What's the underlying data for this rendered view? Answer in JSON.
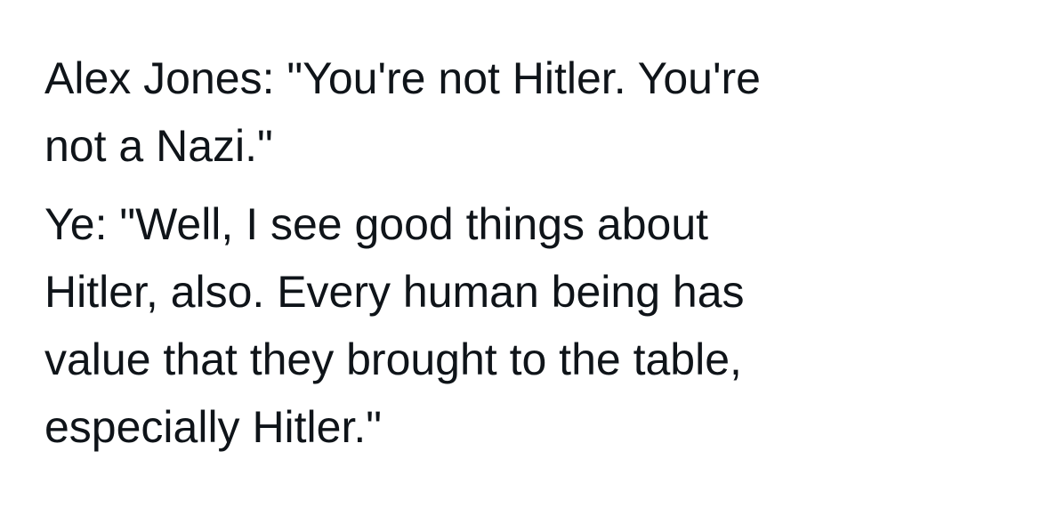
{
  "tweet": {
    "paragraphs": [
      {
        "lines": [
          "Alex Jones: \"You're not Hitler. You're",
          "not a Nazi.\""
        ]
      },
      {
        "lines": [
          "Ye: \"Well, I see good things about",
          "Hitler, also. Every human being has",
          "value that they brought to the table,",
          "especially Hitler.\""
        ]
      }
    ]
  },
  "colors": {
    "text": "#0f1419",
    "background": "#ffffff"
  }
}
